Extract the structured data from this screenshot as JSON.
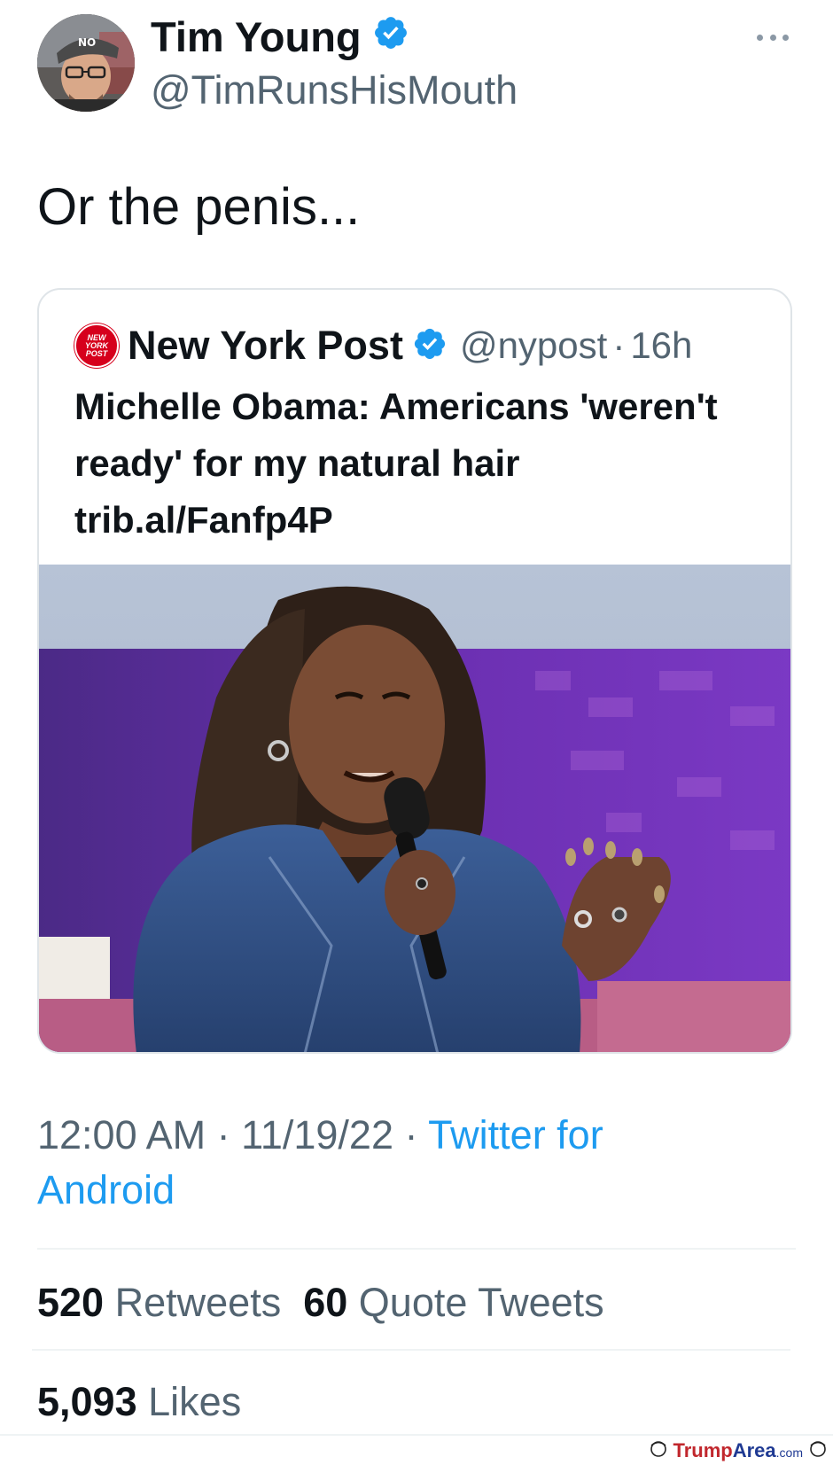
{
  "author": {
    "name": "Tim Young",
    "handle": "@TimRunsHisMouth",
    "verified": true,
    "verified_color": "#1d9bf0"
  },
  "tweet": {
    "text": "Or the penis..."
  },
  "quoted_tweet": {
    "logo_text": [
      "NEW",
      "YORK",
      "POST"
    ],
    "name": "New York Post",
    "handle": "@nypost",
    "separator": "·",
    "time": "16h",
    "text": "Michelle Obama: Americans 'weren't ready' for my natural hair trib.al/Fanfp4P"
  },
  "meta": {
    "time": "12:00 AM",
    "sep1": " · ",
    "date": "11/19/22",
    "sep2": " · ",
    "source": "Twitter for Android"
  },
  "stats": {
    "retweets_count": "520",
    "retweets_label": "Retweets",
    "quotes_count": "60",
    "quotes_label": "Quote Tweets",
    "likes_count": "5,093",
    "likes_label": "Likes"
  },
  "watermark": {
    "part1": "Trump",
    "part2": "Area",
    "part3": ".com"
  },
  "colors": {
    "text_primary": "#0f1419",
    "text_secondary": "#536471",
    "link": "#1d9bf0",
    "nypost_red": "#d6001c"
  },
  "icons": [
    "avatar",
    "verified-badge-icon",
    "more-options-icon",
    "nypost-logo-icon",
    "watermark-face-icon"
  ]
}
